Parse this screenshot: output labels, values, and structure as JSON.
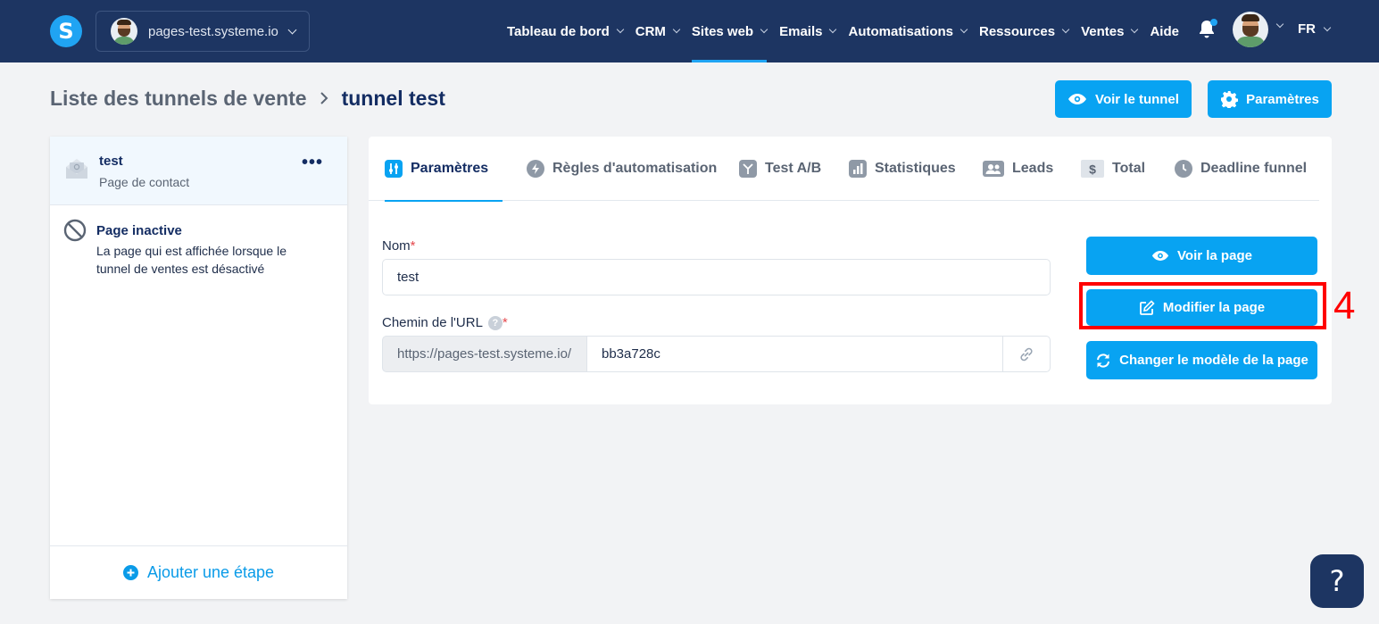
{
  "nav": {
    "logo": "S",
    "workspace": "pages-test.systeme.io",
    "items": [
      {
        "label": "Tableau de bord",
        "active": false
      },
      {
        "label": "CRM",
        "active": false
      },
      {
        "label": "Sites web",
        "active": true
      },
      {
        "label": "Emails",
        "active": false
      },
      {
        "label": "Automatisations",
        "active": false
      },
      {
        "label": "Ressources",
        "active": false
      },
      {
        "label": "Ventes",
        "active": false
      },
      {
        "label": "Aide",
        "active": false
      }
    ],
    "language": "FR"
  },
  "breadcrumb": {
    "parent": "Liste des tunnels de vente",
    "current": "tunnel test"
  },
  "header_buttons": {
    "view_tunnel": "Voir le tunnel",
    "settings": "Paramètres"
  },
  "sidebar": {
    "active_step": {
      "title": "test",
      "subtitle": "Page de contact",
      "menu": "•••"
    },
    "inactive_page": {
      "title": "Page inactive",
      "description": "La page qui est affichée lorsque le tunnel de ventes est désactivé"
    },
    "add_step": "Ajouter une étape"
  },
  "tabs": [
    {
      "label": "Paramètres",
      "icon": "sliders-icon",
      "active": true
    },
    {
      "label": "Règles d'automatisation",
      "icon": "bolt-icon",
      "active": false
    },
    {
      "label": "Test A/B",
      "icon": "split-icon",
      "active": false
    },
    {
      "label": "Statistiques",
      "icon": "bar-chart-icon",
      "active": false
    },
    {
      "label": "Leads",
      "icon": "users-icon",
      "active": false
    },
    {
      "label": "Total",
      "icon": "dollar-icon",
      "active": false
    },
    {
      "label": "Deadline funnel",
      "icon": "clock-icon",
      "active": false
    }
  ],
  "form": {
    "name_label": "Nom",
    "required_mark": "*",
    "name_value": "test",
    "url_label": "Chemin de l'URL",
    "help_mark": "?",
    "url_prefix": "https://pages-test.systeme.io/",
    "url_value": "bb3a728c"
  },
  "actions": {
    "view_page": "Voir la page",
    "edit_page": "Modifier la page",
    "change_template": "Changer le modèle de la page"
  },
  "annotation": "4",
  "help_button": "?",
  "colors": {
    "nav_bg": "#1d3562",
    "accent": "#08a3f2",
    "highlight": "#ff0000"
  }
}
